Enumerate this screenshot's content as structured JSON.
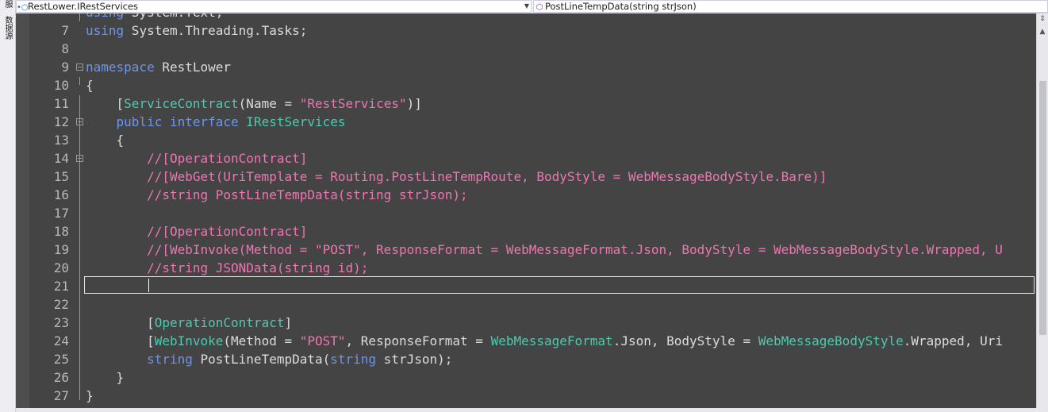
{
  "side_tabs": [
    "服",
    "数据源"
  ],
  "navbar": {
    "left_combo": "RestLower.IRestServices",
    "right_combo": "PostLineTempData(string strJson)"
  },
  "editor": {
    "lines": [
      {
        "n": "",
        "parts": [
          [
            "kw",
            "using"
          ],
          [
            "pl",
            " System.Text;"
          ]
        ]
      },
      {
        "n": "7",
        "parts": [
          [
            "kw",
            "using"
          ],
          [
            "pl",
            " System.Threading.Tasks;"
          ]
        ]
      },
      {
        "n": "8",
        "parts": []
      },
      {
        "n": "9",
        "parts": [
          [
            "kw",
            "namespace"
          ],
          [
            "pl",
            " RestLower"
          ]
        ]
      },
      {
        "n": "10",
        "parts": [
          [
            "pl",
            "{"
          ]
        ]
      },
      {
        "n": "11",
        "parts": [
          [
            "pl",
            "    ["
          ],
          [
            "ty",
            "ServiceContract"
          ],
          [
            "pl",
            "(Name = "
          ],
          [
            "str",
            "\"RestServices\""
          ],
          [
            "pl",
            ")]"
          ]
        ]
      },
      {
        "n": "12",
        "parts": [
          [
            "pl",
            "    "
          ],
          [
            "kw",
            "public interface"
          ],
          [
            "pl",
            " "
          ],
          [
            "ty",
            "IRestServices"
          ]
        ]
      },
      {
        "n": "13",
        "parts": [
          [
            "pl",
            "    {"
          ]
        ]
      },
      {
        "n": "14",
        "parts": [
          [
            "cm",
            "        //[OperationContract]"
          ]
        ]
      },
      {
        "n": "15",
        "parts": [
          [
            "cm",
            "        //[WebGet(UriTemplate = Routing.PostLineTempRoute, BodyStyle = WebMessageBodyStyle.Bare)]"
          ]
        ]
      },
      {
        "n": "16",
        "parts": [
          [
            "cm",
            "        //string PostLineTempData(string strJson);"
          ]
        ]
      },
      {
        "n": "17",
        "parts": []
      },
      {
        "n": "18",
        "parts": [
          [
            "cm",
            "        //[OperationContract]"
          ]
        ]
      },
      {
        "n": "19",
        "parts": [
          [
            "cm",
            "        //[WebInvoke(Method = \"POST\", ResponseFormat = WebMessageFormat.Json, BodyStyle = WebMessageBodyStyle.Wrapped, U"
          ]
        ]
      },
      {
        "n": "20",
        "parts": [
          [
            "cm",
            "        //string JSONData(string id);"
          ]
        ]
      },
      {
        "n": "21",
        "parts": []
      },
      {
        "n": "22",
        "parts": []
      },
      {
        "n": "23",
        "parts": [
          [
            "pl",
            "        ["
          ],
          [
            "ty",
            "OperationContract"
          ],
          [
            "pl",
            "]"
          ]
        ]
      },
      {
        "n": "24",
        "parts": [
          [
            "pl",
            "        ["
          ],
          [
            "ty",
            "WebInvoke"
          ],
          [
            "pl",
            "(Method = "
          ],
          [
            "str",
            "\"POST\""
          ],
          [
            "pl",
            ", ResponseFormat = "
          ],
          [
            "ty",
            "WebMessageFormat"
          ],
          [
            "pl",
            ".Json, BodyStyle = "
          ],
          [
            "ty",
            "WebMessageBodyStyle"
          ],
          [
            "pl",
            ".Wrapped, Uri"
          ]
        ]
      },
      {
        "n": "25",
        "parts": [
          [
            "pl",
            "        "
          ],
          [
            "kw",
            "string"
          ],
          [
            "pl",
            " PostLineTempData("
          ],
          [
            "kw",
            "string"
          ],
          [
            "pl",
            " strJson);"
          ]
        ]
      },
      {
        "n": "26",
        "parts": [
          [
            "pl",
            "    }"
          ]
        ]
      },
      {
        "n": "27",
        "parts": [
          [
            "pl",
            "}"
          ]
        ]
      }
    ],
    "fold_lines": [
      "9",
      "12",
      "14"
    ],
    "current_line": "21",
    "colors": {
      "background": "#444444",
      "keyword": "#6c95eb",
      "type": "#4ec9b0",
      "string": "#ec76b1",
      "comment": "#ec76b1",
      "plain": "#dcdcdc",
      "line_number": "#b8b8b8"
    }
  }
}
